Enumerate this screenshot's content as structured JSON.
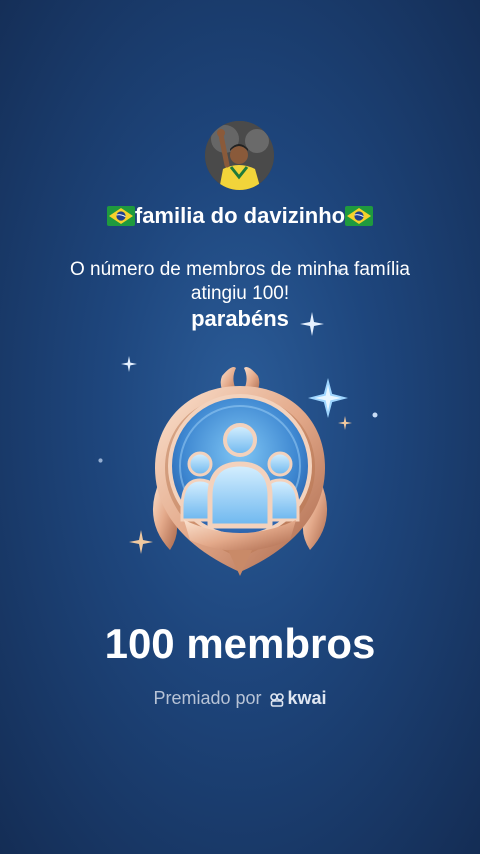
{
  "profile": {
    "family_name": "familia do davizinho",
    "flag_icon": "brazil-flag-icon"
  },
  "message": {
    "text": "O número de membros de minha família atingiu 100!",
    "congrats": "parabéns"
  },
  "badge": {
    "icon": "family-members-badge-icon"
  },
  "milestone": {
    "count_label": "100 membros"
  },
  "footer": {
    "awarded_by": "Premiado por",
    "brand": "kwai",
    "brand_icon": "kwai-logo-icon"
  },
  "colors": {
    "background": "#1e467d",
    "text": "#ffffff",
    "muted_text": "#b7c3d6",
    "badge_gold": "#e8b49a",
    "badge_blue": "#5fb0ec"
  }
}
